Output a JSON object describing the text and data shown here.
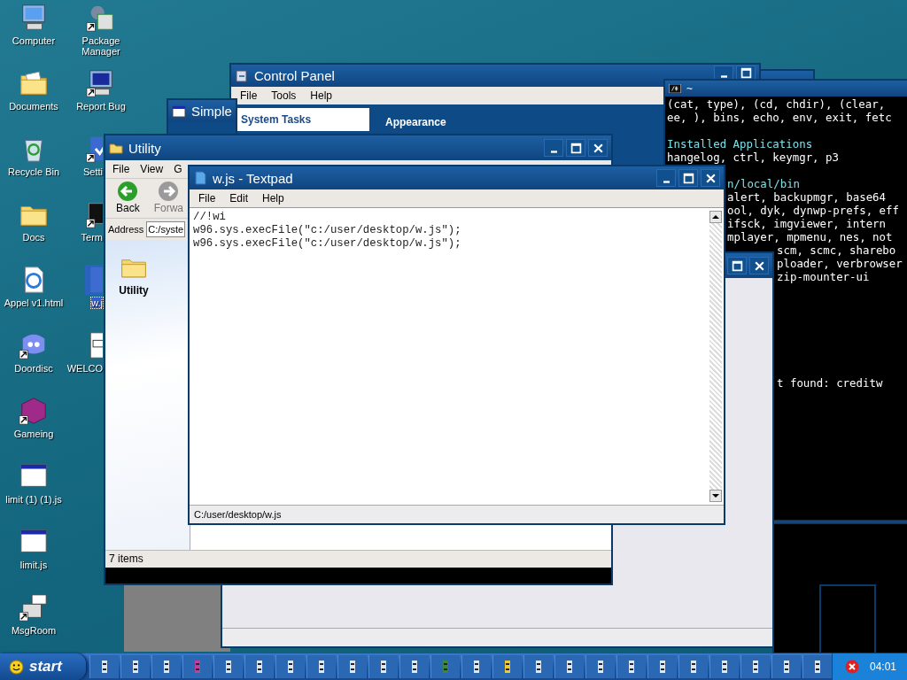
{
  "desktop": {
    "icons_left": [
      {
        "label": "Computer",
        "kind": "computer",
        "shortcut": false,
        "selected": false
      },
      {
        "label": "Documents",
        "kind": "docs-folder",
        "shortcut": false,
        "selected": false
      },
      {
        "label": "Recycle Bin",
        "kind": "recycle",
        "shortcut": false,
        "selected": false
      },
      {
        "label": "Docs",
        "kind": "folder",
        "shortcut": false,
        "selected": false
      },
      {
        "label": "Appel v1.html",
        "kind": "web",
        "shortcut": false,
        "selected": false
      },
      {
        "label": "Doordisc",
        "kind": "chat",
        "shortcut": true,
        "selected": false
      },
      {
        "label": "Gameing",
        "kind": "cube",
        "shortcut": true,
        "selected": false
      },
      {
        "label": "limit (1) (1).js",
        "kind": "window",
        "shortcut": false,
        "selected": false
      },
      {
        "label": "limit.js",
        "kind": "window",
        "shortcut": false,
        "selected": false
      },
      {
        "label": "MsgRoom",
        "kind": "msg",
        "shortcut": true,
        "selected": false
      }
    ],
    "icons_right": [
      {
        "label": "Package Manager",
        "kind": "package",
        "shortcut": true,
        "selected": false
      },
      {
        "label": "Report Bug",
        "kind": "computer-bug",
        "shortcut": true,
        "selected": false
      },
      {
        "label": "Setti",
        "kind": "settings",
        "shortcut": true,
        "selected": false
      },
      {
        "label": "Term",
        "kind": "terminal",
        "shortcut": true,
        "selected": false
      },
      {
        "label": "w.j",
        "kind": "script",
        "shortcut": false,
        "selected": true
      },
      {
        "label": "WELCO",
        "kind": "welcome",
        "shortcut": false,
        "selected": false
      }
    ]
  },
  "control_panel": {
    "title": "Control Panel",
    "menu": [
      "File",
      "Tools",
      "Help"
    ],
    "sidebar_heading": "System Tasks",
    "section_heading": "Appearance"
  },
  "simple_window": {
    "title": "Simple"
  },
  "terminal": {
    "title": "~",
    "lines": [
      {
        "kind": "full",
        "text": "(cat, type), (cd, chdir), (clear,"
      },
      {
        "kind": "full",
        "text": "ee, ), bins, echo, env, exit, fetc"
      },
      {
        "kind": "blank"
      },
      {
        "kind": "heading",
        "text": "Installed Applications"
      },
      {
        "kind": "full",
        "text": "hangelog, ctrl, keymgr, p3"
      },
      {
        "kind": "blank"
      },
      {
        "kind": "heading-behind",
        "text": "n/local/bin"
      },
      {
        "kind": "behind",
        "text": "alert, backupmgr, base64"
      },
      {
        "kind": "behind",
        "text": "ool, dyk, dynwp-prefs, eff"
      },
      {
        "kind": "behind",
        "text": "ifsck, imgviewer, intern"
      },
      {
        "kind": "behind",
        "text": "mplayer, mpmenu, nes, not"
      },
      {
        "kind": "behind-far",
        "text": "scm, scmc, sharebo"
      },
      {
        "kind": "behind-far",
        "text": "ploader, verbrowser"
      },
      {
        "kind": "behind-far",
        "text": "zip-mounter-ui"
      },
      {
        "kind": "blank"
      },
      {
        "kind": "blank"
      },
      {
        "kind": "blank"
      },
      {
        "kind": "blank"
      },
      {
        "kind": "blank"
      },
      {
        "kind": "blank"
      },
      {
        "kind": "blank"
      },
      {
        "kind": "behind-far",
        "text": "t found: creditw"
      }
    ]
  },
  "utility": {
    "title": "Utility",
    "menu": [
      "File",
      "View",
      "G"
    ],
    "toolbar": [
      {
        "label": "Back",
        "kind": "back",
        "disabled": false
      },
      {
        "label": "Forwa",
        "kind": "forward",
        "disabled": true
      }
    ],
    "address_label": "Address",
    "address": "C:/syste",
    "folder_label": "Utility",
    "status": "7 items"
  },
  "textpad": {
    "title": "w.js - Textpad",
    "menu": [
      "File",
      "Edit",
      "Help"
    ],
    "lines": [
      "//!wi",
      "w96.sys.execFile(\"c:/user/desktop/w.js\");",
      "w96.sys.execFile(\"c:/user/desktop/w.js\");"
    ],
    "status": "C:/user/desktop/w.js"
  },
  "taskbar": {
    "start": "start",
    "buttons": [
      {
        "kind": "window"
      },
      {
        "kind": "window"
      },
      {
        "kind": "window"
      },
      {
        "kind": "media"
      },
      {
        "kind": "window"
      },
      {
        "kind": "window"
      },
      {
        "kind": "window"
      },
      {
        "kind": "window"
      },
      {
        "kind": "window"
      },
      {
        "kind": "window"
      },
      {
        "kind": "window"
      },
      {
        "kind": "game"
      },
      {
        "kind": "window"
      },
      {
        "kind": "folder"
      },
      {
        "kind": "window"
      },
      {
        "kind": "window"
      },
      {
        "kind": "window"
      },
      {
        "kind": "window"
      },
      {
        "kind": "window"
      },
      {
        "kind": "window"
      },
      {
        "kind": "window"
      },
      {
        "kind": "window"
      },
      {
        "kind": "window"
      },
      {
        "kind": "window"
      }
    ],
    "clock": "04:01"
  }
}
